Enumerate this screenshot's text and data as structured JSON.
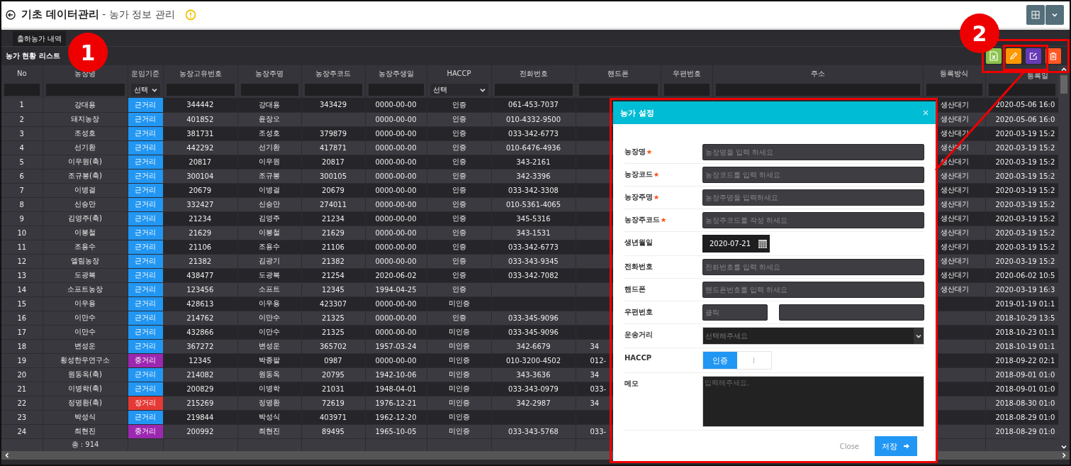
{
  "header": {
    "title": "기초 데이터관리",
    "subtitle": "- 농가 정보 관리"
  },
  "tabs": [
    {
      "label": "출하농가 내역",
      "selected": true
    }
  ],
  "list_title": "농가 현황 리스트",
  "table": {
    "columns": [
      "No",
      "농장명",
      "운임기준",
      "농장고유번호",
      "농장주명",
      "농장주코드",
      "농장주생일",
      "HACCP",
      "전화번호",
      "핸드폰",
      "우편번호",
      "주소",
      "등록방식",
      "등록일"
    ],
    "filters": [
      {
        "kind": "text"
      },
      {
        "kind": "text"
      },
      {
        "kind": "select",
        "value": "선택"
      },
      {
        "kind": "text"
      },
      {
        "kind": "text"
      },
      {
        "kind": "text"
      },
      {
        "kind": "text"
      },
      {
        "kind": "select",
        "value": "선택"
      },
      {
        "kind": "text"
      },
      {
        "kind": "text"
      },
      {
        "kind": "text"
      },
      {
        "kind": "text"
      },
      {
        "kind": "text"
      },
      {
        "kind": "text"
      }
    ],
    "rows": [
      {
        "no": "1",
        "farm_name": "강대용",
        "fare": {
          "label": "근거리",
          "color": "#2196f3"
        },
        "farm_id": "344442",
        "owner": "강대용",
        "owner_code": "343429",
        "birth": "0000-00-00",
        "haccp": "인증",
        "phone": "061-453-7037",
        "reg_method": "생산대기",
        "reg_date": "2020-05-06 16:0"
      },
      {
        "no": "2",
        "farm_name": "돼지농장",
        "fare": {
          "label": "근거리",
          "color": "#2196f3"
        },
        "farm_id": "401852",
        "owner": "윤장오",
        "birth": "0000-00-00",
        "haccp": "인증",
        "phone": "010-4332-9500",
        "reg_method": "생산대기",
        "reg_date": "2020-05-06 16:0"
      },
      {
        "no": "3",
        "farm_name": "조성호",
        "fare": {
          "label": "근거리",
          "color": "#2196f3"
        },
        "farm_id": "381731",
        "owner": "조성호",
        "owner_code": "379879",
        "birth": "0000-00-00",
        "haccp": "인증",
        "phone": "033-342-6773",
        "reg_method": "생산대기",
        "reg_date": "2020-03-19 15:2"
      },
      {
        "no": "4",
        "farm_name": "선기환",
        "fare": {
          "label": "근거리",
          "color": "#2196f3"
        },
        "farm_id": "442292",
        "owner": "선기환",
        "owner_code": "417871",
        "birth": "0000-00-00",
        "haccp": "인증",
        "phone": "010-6476-4936",
        "reg_method": "생산대기",
        "reg_date": "2020-03-19 15:2"
      },
      {
        "no": "5",
        "farm_name": "이우원(축)",
        "fare": {
          "label": "근거리",
          "color": "#2196f3"
        },
        "farm_id": "20817",
        "owner": "이우원",
        "owner_code": "20817",
        "birth": "0000-00-00",
        "haccp": "인증",
        "phone": "343-2161",
        "reg_method": "생산대기",
        "reg_date": "2020-03-19 15:2"
      },
      {
        "no": "6",
        "farm_name": "조규봉(축)",
        "fare": {
          "label": "근거리",
          "color": "#2196f3"
        },
        "farm_id": "300104",
        "owner": "조규봉",
        "owner_code": "300105",
        "birth": "0000-00-00",
        "haccp": "인증",
        "phone": "342-3396",
        "reg_method": "생산대기",
        "reg_date": "2020-03-19 15:2"
      },
      {
        "no": "7",
        "farm_name": "이병걸",
        "fare": {
          "label": "근거리",
          "color": "#2196f3"
        },
        "farm_id": "20679",
        "owner": "이병걸",
        "owner_code": "20679",
        "birth": "0000-00-00",
        "haccp": "인증",
        "phone": "033-342-3308",
        "reg_method": "생산대기",
        "reg_date": "2020-03-19 15:2"
      },
      {
        "no": "8",
        "farm_name": "신승만",
        "fare": {
          "label": "근거리",
          "color": "#2196f3"
        },
        "farm_id": "332427",
        "owner": "신승만",
        "owner_code": "274011",
        "birth": "0000-00-00",
        "haccp": "인증",
        "phone": "010-5361-4065",
        "reg_method": "생산대기",
        "reg_date": "2020-03-19 15:2"
      },
      {
        "no": "9",
        "farm_name": "김영주(축)",
        "fare": {
          "label": "근거리",
          "color": "#2196f3"
        },
        "farm_id": "21234",
        "owner": "김영주",
        "owner_code": "21234",
        "birth": "0000-00-00",
        "haccp": "인증",
        "phone": "345-5316",
        "reg_method": "생산대기",
        "reg_date": "2020-03-19 15:2"
      },
      {
        "no": "10",
        "farm_name": "이봉철",
        "fare": {
          "label": "근거리",
          "color": "#2196f3"
        },
        "farm_id": "21629",
        "owner": "이봉철",
        "owner_code": "21629",
        "birth": "0000-00-00",
        "haccp": "인증",
        "phone": "343-1531",
        "reg_method": "생산대기",
        "reg_date": "2020-03-19 15:2"
      },
      {
        "no": "11",
        "farm_name": "조용수",
        "fare": {
          "label": "근거리",
          "color": "#2196f3"
        },
        "farm_id": "21106",
        "owner": "조용수",
        "owner_code": "21106",
        "birth": "0000-00-00",
        "haccp": "인증",
        "phone": "033-342-6773",
        "reg_method": "생산대기",
        "reg_date": "2020-03-19 15:2"
      },
      {
        "no": "12",
        "farm_name": "엘림농장",
        "fare": {
          "label": "근거리",
          "color": "#2196f3"
        },
        "farm_id": "21382",
        "owner": "김광기",
        "owner_code": "21382",
        "birth": "0000-00-00",
        "haccp": "인증",
        "phone": "033-343-9345",
        "reg_method": "생산대기",
        "reg_date": "2020-03-19 15:2"
      },
      {
        "no": "13",
        "farm_name": "도광복",
        "fare": {
          "label": "근거리",
          "color": "#2196f3"
        },
        "farm_id": "438477",
        "owner": "도광복",
        "owner_code": "21254",
        "birth": "2020-06-02",
        "haccp": "인증",
        "phone": "033-342-7082",
        "reg_method": "생산대기",
        "reg_date": "2020-06-02 10:5"
      },
      {
        "no": "14",
        "farm_name": "소프트농장",
        "fare": {
          "label": "근거리",
          "color": "#2196f3"
        },
        "farm_id": "123456",
        "owner": "소프트",
        "owner_code": "12345",
        "birth": "1994-04-25",
        "haccp": "인증",
        "reg_method": "생산대기",
        "reg_date": "2020-03-19 16:3"
      },
      {
        "no": "15",
        "farm_name": "이우용",
        "fare": {
          "label": "근거리",
          "color": "#2196f3"
        },
        "farm_id": "428613",
        "owner": "이우용",
        "owner_code": "423307",
        "birth": "0000-00-00",
        "haccp": "미인증",
        "reg_date": "2019-01-19 01:1"
      },
      {
        "no": "16",
        "farm_name": "이만수",
        "fare": {
          "label": "근거리",
          "color": "#2196f3"
        },
        "farm_id": "214762",
        "owner": "이만수",
        "owner_code": "21325",
        "birth": "0000-00-00",
        "haccp": "인증",
        "phone": "033-345-9096",
        "reg_date": "2018-10-29 13:5"
      },
      {
        "no": "17",
        "farm_name": "이만수",
        "fare": {
          "label": "근거리",
          "color": "#2196f3"
        },
        "farm_id": "432866",
        "owner": "이만수",
        "owner_code": "21325",
        "birth": "0000-00-00",
        "haccp": "미인증",
        "phone": "033-345-9096",
        "reg_date": "2018-10-23 01:1"
      },
      {
        "no": "18",
        "farm_name": "변성운",
        "fare": {
          "label": "근거리",
          "color": "#2196f3"
        },
        "farm_id": "367272",
        "owner": "변성운",
        "owner_code": "365702",
        "birth": "1957-03-24",
        "haccp": "미인증",
        "phone": "342-6679",
        "mobile": "34",
        "reg_date": "2018-10-19 01:1"
      },
      {
        "no": "19",
        "farm_name": "횡성한우연구소",
        "fare": {
          "label": "중거리",
          "color": "#9c27b0"
        },
        "farm_id": "12345",
        "owner": "박종팔",
        "owner_code": "0987",
        "birth": "0000-00-00",
        "haccp": "미인증",
        "phone": "010-3200-4502",
        "mobile": "012-",
        "reg_date": "2018-09-22 02:1"
      },
      {
        "no": "20",
        "farm_name": "원동옥(축)",
        "fare": {
          "label": "근거리",
          "color": "#2196f3"
        },
        "farm_id": "214082",
        "owner": "원동옥",
        "owner_code": "20795",
        "birth": "1942-10-06",
        "haccp": "미인증",
        "phone": "343-3636",
        "mobile": "34",
        "reg_date": "2018-09-01 01:0"
      },
      {
        "no": "21",
        "farm_name": "이병학(축)",
        "fare": {
          "label": "근거리",
          "color": "#2196f3"
        },
        "farm_id": "200829",
        "owner": "이병학",
        "owner_code": "21031",
        "birth": "1948-04-01",
        "haccp": "미인증",
        "phone": "033-343-0979",
        "mobile": "033-",
        "reg_date": "2018-09-01 01:0"
      },
      {
        "no": "22",
        "farm_name": "정명환(축)",
        "fare": {
          "label": "장거리",
          "color": "#e53935"
        },
        "farm_id": "215269",
        "owner": "정명환",
        "owner_code": "72619",
        "birth": "1976-12-21",
        "haccp": "미인증",
        "phone": "342-2987",
        "mobile": "34",
        "reg_date": "2018-08-30 01:0"
      },
      {
        "no": "23",
        "farm_name": "박성식",
        "fare": {
          "label": "근거리",
          "color": "#2196f3"
        },
        "farm_id": "219844",
        "owner": "박성식",
        "owner_code": "403971",
        "birth": "1962-12-20",
        "haccp": "미인증",
        "reg_date": "2018-08-29 01:0"
      },
      {
        "no": "24",
        "farm_name": "최현진",
        "fare": {
          "label": "중거리",
          "color": "#9c27b0"
        },
        "farm_id": "200992",
        "owner": "최현진",
        "owner_code": "89495",
        "birth": "1965-10-05",
        "haccp": "미인증",
        "phone": "033-343-5768",
        "mobile": "033-",
        "reg_date": "2018-08-29 01:0"
      }
    ],
    "total": "총 : 914"
  },
  "dialog": {
    "title": "농가 설정",
    "fields": [
      {
        "label": "농장명",
        "required": true,
        "kind": "text",
        "placeholder": "농장명을 입력 하세요"
      },
      {
        "label": "농장코드",
        "required": true,
        "kind": "text",
        "placeholder": "농장코드를 입력 하세요"
      },
      {
        "label": "농장주명",
        "required": true,
        "kind": "text",
        "placeholder": "농장주명을 입력하세요"
      },
      {
        "label": "농장주코드",
        "required": true,
        "kind": "text",
        "placeholder": "농장주코드를 작성 하세요"
      },
      {
        "label": "생년월일",
        "required": false,
        "kind": "date",
        "value": "2020-07-21"
      },
      {
        "label": "전화번호",
        "required": false,
        "kind": "text",
        "placeholder": "전화번호를 입력 하세요"
      },
      {
        "label": "핸드폰",
        "required": false,
        "kind": "text",
        "placeholder": "핸드폰번호를 입력 하세요"
      },
      {
        "label": "우편번호",
        "required": false,
        "kind": "zip",
        "placeholder": "클릭"
      },
      {
        "label": "운송거리",
        "required": false,
        "kind": "select",
        "placeholder": "선택해주세요"
      },
      {
        "label": "HACCP",
        "required": false,
        "kind": "toggle",
        "options": [
          {
            "label": "인증",
            "selected": true
          },
          {
            "selected": false
          }
        ]
      },
      {
        "label": "메모",
        "required": false,
        "kind": "textarea",
        "placeholder": "입력해주세요."
      }
    ],
    "close": "Close",
    "save": "저장"
  },
  "annotations": [
    {
      "label": "1"
    },
    {
      "label": "2"
    }
  ]
}
